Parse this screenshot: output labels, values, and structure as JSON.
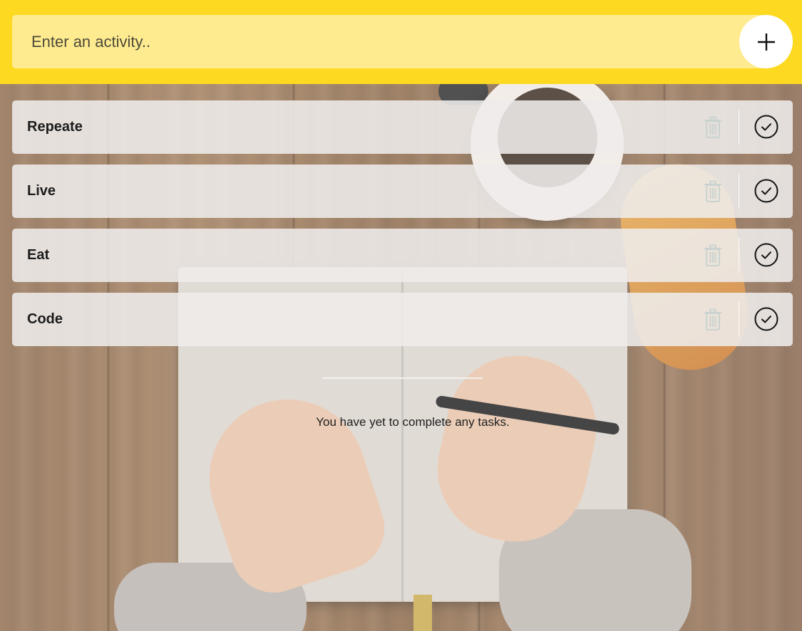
{
  "header": {
    "input_placeholder": "Enter an activity..",
    "add_icon": "plus-icon",
    "background_color": "#fdd922"
  },
  "todos": [
    {
      "label": "Repeate",
      "remove_icon": "trash-icon",
      "complete_icon": "check-circle-icon"
    },
    {
      "label": "Live",
      "remove_icon": "trash-icon",
      "complete_icon": "check-circle-icon"
    },
    {
      "label": "Eat",
      "remove_icon": "trash-icon",
      "complete_icon": "check-circle-icon"
    },
    {
      "label": "Code",
      "remove_icon": "trash-icon",
      "complete_icon": "check-circle-icon"
    }
  ],
  "completed": {
    "empty_message": "You have yet to complete any tasks."
  },
  "colors": {
    "accent": "#fdd922",
    "input_bg": "#feeb8f",
    "item_bg": "#eeeceb"
  }
}
